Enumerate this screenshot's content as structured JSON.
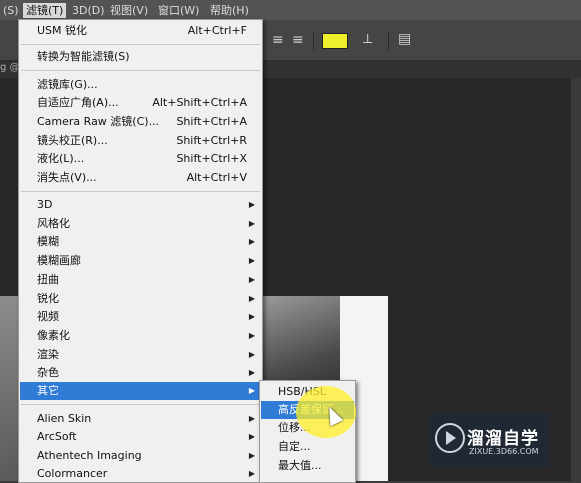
{
  "menubar": {
    "items": [
      "(S)",
      "滤镜(T)",
      "3D(D)",
      "视图(V)",
      "窗口(W)",
      "帮助(H)"
    ],
    "active_index": 1
  },
  "doc_tab": {
    "title_fragment": "g @"
  },
  "swatch_color": "#eef02c",
  "filter_menu": {
    "items": [
      {
        "label": "USM 锐化",
        "shortcut": "Alt+Ctrl+F"
      },
      {
        "label": "转换为智能滤镜(S)",
        "shortcut": ""
      },
      {
        "label": "滤镜库(G)...",
        "shortcut": ""
      },
      {
        "label": "自适应广角(A)...",
        "shortcut": "Alt+Shift+Ctrl+A"
      },
      {
        "label": "Camera Raw 滤镜(C)...",
        "shortcut": "Shift+Ctrl+A"
      },
      {
        "label": "镜头校正(R)...",
        "shortcut": "Shift+Ctrl+R"
      },
      {
        "label": "液化(L)...",
        "shortcut": "Shift+Ctrl+X"
      },
      {
        "label": "消失点(V)...",
        "shortcut": "Alt+Ctrl+V"
      },
      {
        "label": "3D",
        "submenu": true
      },
      {
        "label": "风格化",
        "submenu": true
      },
      {
        "label": "模糊",
        "submenu": true
      },
      {
        "label": "模糊画廊",
        "submenu": true
      },
      {
        "label": "扭曲",
        "submenu": true
      },
      {
        "label": "锐化",
        "submenu": true
      },
      {
        "label": "视频",
        "submenu": true
      },
      {
        "label": "像素化",
        "submenu": true
      },
      {
        "label": "渲染",
        "submenu": true
      },
      {
        "label": "杂色",
        "submenu": true
      },
      {
        "label": "其它",
        "submenu": true,
        "highlighted": true
      },
      {
        "label": "Alien Skin",
        "submenu": true
      },
      {
        "label": "ArcSoft",
        "submenu": true
      },
      {
        "label": "Athentech Imaging",
        "submenu": true
      },
      {
        "label": "Colormancer",
        "submenu": true
      }
    ]
  },
  "other_submenu": {
    "items": [
      {
        "label": "HSB/HSL"
      },
      {
        "label": "高反差保留...",
        "highlighted": true
      },
      {
        "label": "位移..."
      },
      {
        "label": "自定..."
      },
      {
        "label": "最大值..."
      }
    ]
  },
  "watermark": {
    "title": "溜溜自学",
    "url": "ZIXUE.3D66.COM"
  }
}
